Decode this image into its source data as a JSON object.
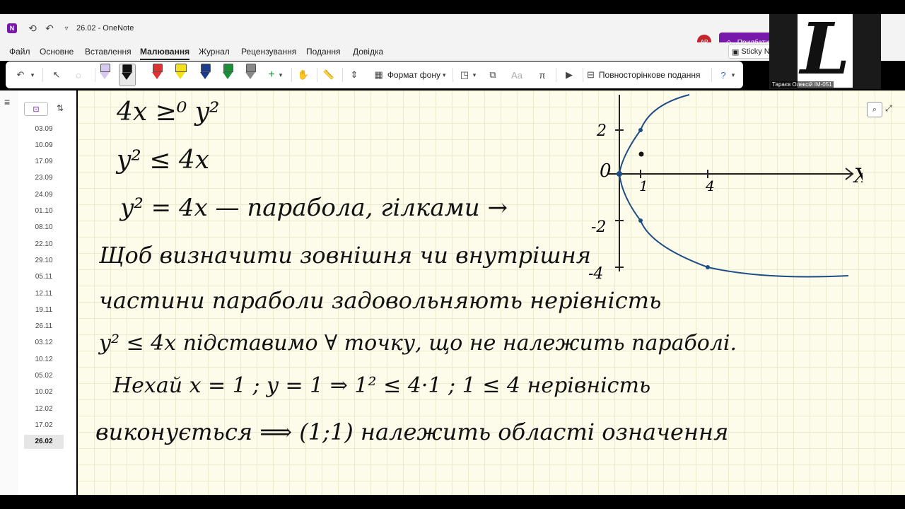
{
  "titlebar": {
    "app_icon": "onenote-icon",
    "doc_title": "26.02  -  OneNote",
    "avatar_initials": "АР",
    "premium_label": "Придбати"
  },
  "menu": {
    "items": [
      "Файл",
      "Основне",
      "Вставлення",
      "Малювання",
      "Журнал",
      "Рецензування",
      "Подання",
      "Довідка"
    ],
    "active": "Малювання",
    "sticky_notes": "Sticky No"
  },
  "ribbon": {
    "background_format": "Формат фону",
    "full_page_view": "Повносторінкове подання"
  },
  "webcam": {
    "name": "Тараєв Олексій ІМ-051",
    "logo_letter": "L"
  },
  "pages": {
    "items": [
      "03.09",
      "10.09",
      "17.09",
      "23.09",
      "24.09",
      "01.10",
      "08.10",
      "22.10",
      "29.10",
      "05.11",
      "12.11",
      "19.11",
      "26.11",
      "03.12",
      "10.12",
      "05.02",
      "10.02",
      "12.02",
      "17.02",
      "26.02"
    ],
    "active": "26.02"
  },
  "note": {
    "line1": "4x ≥⁰ y²",
    "line2": "y² ≤ 4x",
    "line3": "y² = 4x — парабола, гілками →",
    "line4": "Щоб визначити зовнішня чи внутрішня",
    "line5": "частини параболи задовольняють нерівність",
    "line6": "y² ≤ 4x   підставимо ∀ точку, що не належить параболі.",
    "line7": "Нехай   x = 1 ; y = 1   ⇒   1² ≤ 4·1 ;   1 ≤ 4   нерівність",
    "line8": "виконується ⟹ (1;1) належить області означення"
  },
  "graph": {
    "x_axis_label": "X",
    "origin_label": "0",
    "x_ticks": [
      "1",
      "4"
    ],
    "y_ticks": [
      "2",
      "-2",
      "-4"
    ],
    "sample_point": [
      1,
      1
    ]
  }
}
